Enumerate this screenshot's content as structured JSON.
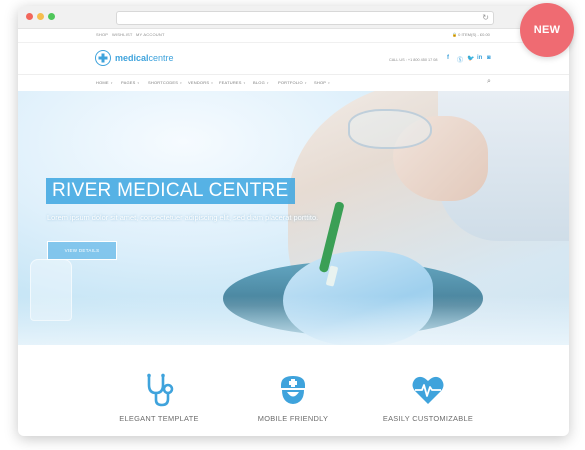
{
  "top_links": [
    "SHOP",
    "WISHLIST",
    "MY ACCOUNT"
  ],
  "cart": {
    "text": "0 ITEM(S) - £0.00"
  },
  "logo": {
    "part1": "medical",
    "part2": "centre"
  },
  "contact": {
    "text": "CALL US : +1 800 450 17 08"
  },
  "social_icons": [
    "facebook-icon",
    "skype-icon",
    "twitter-icon",
    "linkedin-icon",
    "instagram-icon"
  ],
  "nav": {
    "items": [
      {
        "label": "HOME",
        "icon": "chevron-down-icon"
      },
      {
        "label": "PAGES",
        "icon": "chevron-down-icon"
      },
      {
        "label": "SHORTCODES",
        "icon": "chevron-down-icon"
      },
      {
        "label": "VENDORS",
        "icon": "chevron-down-icon"
      },
      {
        "label": "FEATURES",
        "icon": "chevron-down-icon"
      },
      {
        "label": "BLOG",
        "icon": "chevron-down-icon"
      },
      {
        "label": "PORTFOLIO",
        "icon": "chevron-down-icon"
      },
      {
        "label": "SHOP",
        "icon": "chevron-down-icon"
      }
    ],
    "search_icon": "search-icon"
  },
  "hero": {
    "title": "RIVER MEDICAL CENTRE",
    "subtitle": "Lorem ipsum dolor sit amet, consectetuer adipiscing elit, sed diam placerat porttito.",
    "button": "VIEW DETAILS"
  },
  "features": [
    {
      "label": "ELEGANT TEMPLATE",
      "icon": "stethoscope-icon"
    },
    {
      "label": "MOBILE FRIENDLY",
      "icon": "nurse-icon"
    },
    {
      "label": "EASILY CUSTOMIZABLE",
      "icon": "heartbeat-icon"
    }
  ],
  "badge": "NEW",
  "colors": {
    "accent": "#3fa3dc",
    "badge": "#ef6b72"
  }
}
